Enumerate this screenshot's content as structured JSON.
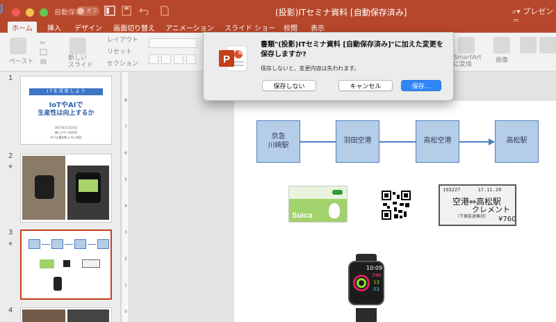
{
  "window": {
    "title": "(投影)ITセミナ資料 [自動保存済み]",
    "autosave_label": "自動保存",
    "autosave_state": "オフ",
    "search_placeholder": "プレゼンテ"
  },
  "ribbon_tabs": [
    "ホーム",
    "挿入",
    "デザイン",
    "画面切り替え",
    "アニメーション",
    "スライド ショー",
    "校閲",
    "表示"
  ],
  "ribbon": {
    "paste": "ペースト",
    "new_slide": "新しい\nスライド",
    "layout": "レイアウト",
    "reset": "リセット",
    "section": "セクション",
    "smartart": "SmartArt\nに変換",
    "image": "画像"
  },
  "thumbnails": {
    "numbers": [
      "1",
      "2",
      "3",
      "4"
    ],
    "slide1": {
      "banner": "I T を 活 用 し よ う",
      "title_line1": "IoTやAIで",
      "title_line2": "生産性は向上するか",
      "date": "2017年11月23日",
      "org": "株仁ボケト研究所",
      "dept": "中小企業診断士  村上知也"
    }
  },
  "slide3": {
    "flow": [
      "京急\n川崎駅",
      "羽田空港",
      "高松空港",
      "高松駅"
    ],
    "ticket_line1": "193227      17.11.20",
    "ticket_line2": "空港⇔高松駅",
    "ticket_line3": "クレメント",
    "ticket_line4": "〔下車前途無効〕",
    "ticket_price": "¥760",
    "watch_time": "10:09",
    "watch_stats": [
      "396",
      "13",
      "03"
    ],
    "suica_label": "Suica"
  },
  "dialog": {
    "message": "書類\"(投影)ITセミナ資料 [自動保存済み]\"に加えた変更を保存しますか?",
    "sub": "保存しないと、変更内容は失われます。",
    "dont_save": "保存しない",
    "cancel": "キャンセル",
    "save": "保存..."
  },
  "colors": {
    "accent": "#b7472a",
    "primary_button": "#2f86f6",
    "flow_box": "#b6cde8",
    "flow_border": "#4c7fbf",
    "selected_thumb": "#c43e1c"
  }
}
